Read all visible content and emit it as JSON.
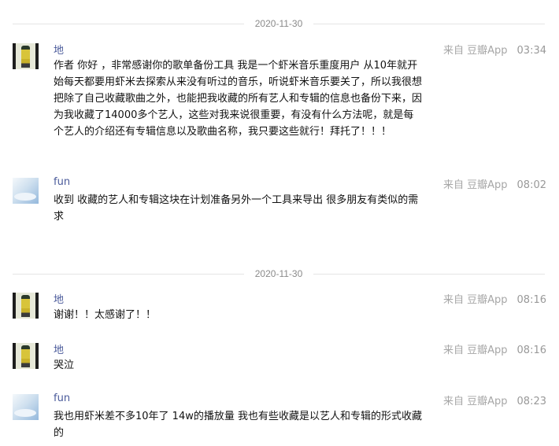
{
  "conversation": {
    "groups": [
      {
        "date": "2020-11-30",
        "messages": [
          {
            "user": "地",
            "source": "来自 豆瓣App",
            "time": "03:34",
            "text": "作者 你好 ，非常感谢你的歌单备份工具 我是一个虾米音乐重度用户 从10年就开始每天都要用虾米去探索从来没有听过的音乐，听说虾米音乐要关了，所以我很想把除了自己收藏歌曲之外，也能把我收藏的所有艺人和专辑的信息也备份下来，因为我收藏了14000多个艺人，这些对我来说很重要，有没有什么方法呢，就是每个艺人的介绍还有专辑信息以及歌曲名称，我只要这些就行！拜托了！！！"
          },
          {
            "user": "fun",
            "source": "来自 豆瓣App",
            "time": "08:02",
            "text": "收到 收藏的艺人和专辑这块在计划准备另外一个工具来导出 很多朋友有类似的需求"
          }
        ]
      },
      {
        "date": "2020-11-30",
        "messages": [
          {
            "user": "地",
            "source": "来自 豆瓣App",
            "time": "08:16",
            "text": "谢谢！！太感谢了！！"
          },
          {
            "user": "地",
            "source": "来自 豆瓣App",
            "time": "08:16",
            "text": "哭泣"
          },
          {
            "user": "fun",
            "source": "来自 豆瓣App",
            "time": "08:23",
            "text": "我也用虾米差不多10年了 14w的播放量 我也有些收藏是以艺人和专辑的形式收藏的"
          }
        ]
      }
    ]
  }
}
